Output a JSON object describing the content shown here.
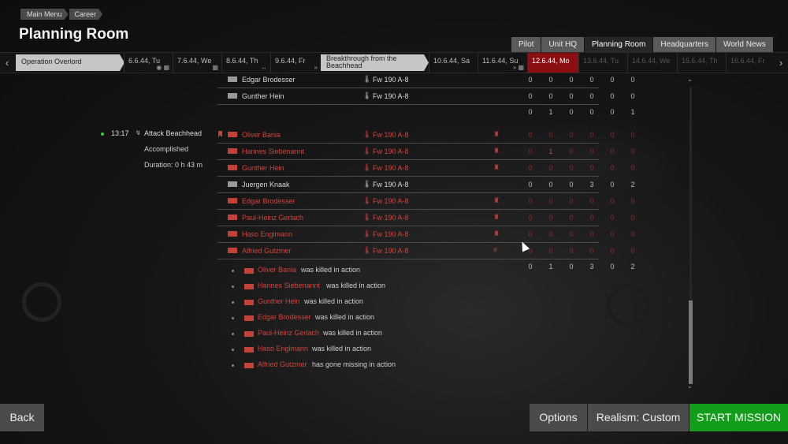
{
  "breadcrumb": [
    "Main Menu",
    "Career"
  ],
  "page_title": "Planning Room",
  "tabs": [
    "Pilot",
    "Unit HQ",
    "Planning Room",
    "Headquarters",
    "World News"
  ],
  "active_tab": "Planning Room",
  "timeline": {
    "prev_icon": "chevron-left-icon",
    "next_icon": "chevron-right-icon",
    "operations": [
      "Operation Overlord",
      "Breakthrough from the Beachhead"
    ],
    "days": [
      {
        "num": "6",
        "rest": ".6.44, Tu",
        "icons": "◉ ▦"
      },
      {
        "num": "7",
        "rest": ".6.44, We",
        "icons": "▦"
      },
      {
        "num": "8",
        "rest": ".6.44, Th",
        "icons": "↔"
      },
      {
        "num": "9",
        "rest": ".6.44, Fr",
        "icons": "»"
      },
      {
        "num": "10",
        "rest": ".6.44, Sa",
        "icons": ""
      },
      {
        "num": "11",
        "rest": ".6.44, Su",
        "icons": "» ▦"
      },
      {
        "num": "12",
        "rest": ".6.44, Mo",
        "icons": ""
      },
      {
        "num": "13",
        "rest": ".6.44, Tu",
        "icons": ""
      },
      {
        "num": "14",
        "rest": ".6.44, We",
        "icons": ""
      },
      {
        "num": "15",
        "rest": ".6.44, Th",
        "icons": ""
      },
      {
        "num": "16",
        "rest": ".6.44, Fr",
        "icons": ""
      }
    ]
  },
  "prev_sortie": {
    "rows": [
      {
        "name": "Edgar Brodesser",
        "plane": "Fw 190 A-8",
        "stats": [
          "0",
          "0",
          "0",
          "0",
          "0",
          "0"
        ]
      },
      {
        "name": "Gunther Hein",
        "plane": "Fw 190 A-8",
        "stats": [
          "0",
          "0",
          "0",
          "0",
          "0",
          "0"
        ]
      }
    ],
    "totals": [
      "0",
      "1",
      "0",
      "0",
      "0",
      "1"
    ]
  },
  "sortie": {
    "time": "13:17",
    "task": "Attack Beachhead",
    "result": "Accomplished",
    "duration": "Duration: 0 h 43 m",
    "rows": [
      {
        "name": "Oliver Bania",
        "plane": "Fw 190 A-8",
        "status": "♜",
        "stats": [
          "0",
          "0",
          "0",
          "0",
          "0",
          "0"
        ]
      },
      {
        "name": "Hannes Siebenannt",
        "plane": "Fw 190 A-8",
        "status": "♜",
        "stats": [
          "0",
          "1",
          "0",
          "0",
          "0",
          "0"
        ]
      },
      {
        "name": "Gunther Hein",
        "plane": "Fw 190 A-8",
        "status": "♜",
        "stats": [
          "0",
          "0",
          "0",
          "0",
          "0",
          "0"
        ]
      },
      {
        "name": "Juergen Knaak",
        "plane": "Fw 190 A-8",
        "status": "",
        "stats": [
          "0",
          "0",
          "0",
          "3",
          "0",
          "2"
        ]
      },
      {
        "name": "Edgar Brodesser",
        "plane": "Fw 190 A-8",
        "status": "♜",
        "stats": [
          "0",
          "0",
          "0",
          "0",
          "0",
          "0"
        ]
      },
      {
        "name": "Paul-Heinz Gerlach",
        "plane": "Fw 190 A-8",
        "status": "♜",
        "stats": [
          "0",
          "0",
          "0",
          "0",
          "0",
          "0"
        ]
      },
      {
        "name": "Haso Englmann",
        "plane": "Fw 190 A-8",
        "status": "♜",
        "stats": [
          "0",
          "0",
          "0",
          "0",
          "0",
          "0"
        ]
      },
      {
        "name": "Alfried Gutzmer",
        "plane": "Fw 190 A-8",
        "status": "#",
        "stats": [
          "0",
          "0",
          "0",
          "0",
          "0",
          "0"
        ]
      }
    ],
    "totals": [
      "0",
      "1",
      "0",
      "3",
      "0",
      "2"
    ]
  },
  "events": [
    {
      "who": "Oliver Bania",
      "what": "was killed in action"
    },
    {
      "who": "Hannes Siebenannt",
      "what": "was killed in action"
    },
    {
      "who": "Gunther Hein",
      "what": "was killed in action"
    },
    {
      "who": "Edgar Brodesser",
      "what": "was killed in action"
    },
    {
      "who": "Paul-Heinz Gerlach",
      "what": "was killed in action"
    },
    {
      "who": "Haso Englmann",
      "what": "was killed in action"
    },
    {
      "who": "Alfried Gutzmer",
      "what": "has gone missing in action"
    }
  ],
  "buttons": {
    "back": "Back",
    "options": "Options",
    "realism": "Realism: Custom",
    "start": "START MISSION"
  },
  "colors": {
    "accent_red": "#d0443c",
    "current_day": "#8a0e12",
    "start_green": "#129d1a",
    "status_dot": "#2ecc40"
  }
}
